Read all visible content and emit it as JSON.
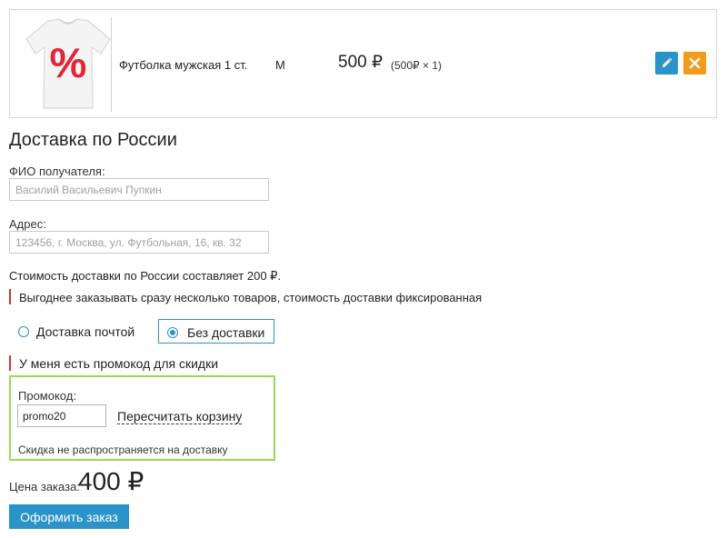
{
  "cart_item": {
    "name": "Футболка мужская 1 ст.",
    "size": "M",
    "price": "500 ₽",
    "calc": "(500₽ × 1)",
    "shirt_print": "%"
  },
  "actions": {
    "edit_icon": "pencil-icon",
    "delete_icon": "close-icon"
  },
  "delivery": {
    "heading": "Доставка по России",
    "name_label": "ФИО получателя:",
    "name_placeholder": "Василий Васильевич Пупкин",
    "address_label": "Адрес:",
    "address_placeholder": "123456, г. Москва, ул. Футбольная, 16, кв. 32",
    "cost_text": "Стоимость доставки по России составляет 200 ₽.",
    "note_text": "Выгоднее заказывать сразу несколько товаров, стоимость доставки фиксированная",
    "options": [
      "Доставка почтой",
      "Без доставки"
    ],
    "selected_option": "Без доставки"
  },
  "promo": {
    "toggle_text": "У меня есть промокод для скидки",
    "label": "Промокод:",
    "value": "promo20",
    "recalc_label": "Пересчитать корзину",
    "note": "Скидка не распространяется на доставку"
  },
  "order": {
    "price_label": "Цена заказа:",
    "total": "400 ₽",
    "submit_label": "Оформить заказ"
  },
  "colors": {
    "accent": "#2a93c9",
    "delete": "#f39a1c",
    "warning_bar": "#d9322a",
    "promo_border": "#9ed65a",
    "shirt_print": "#e0263a"
  }
}
